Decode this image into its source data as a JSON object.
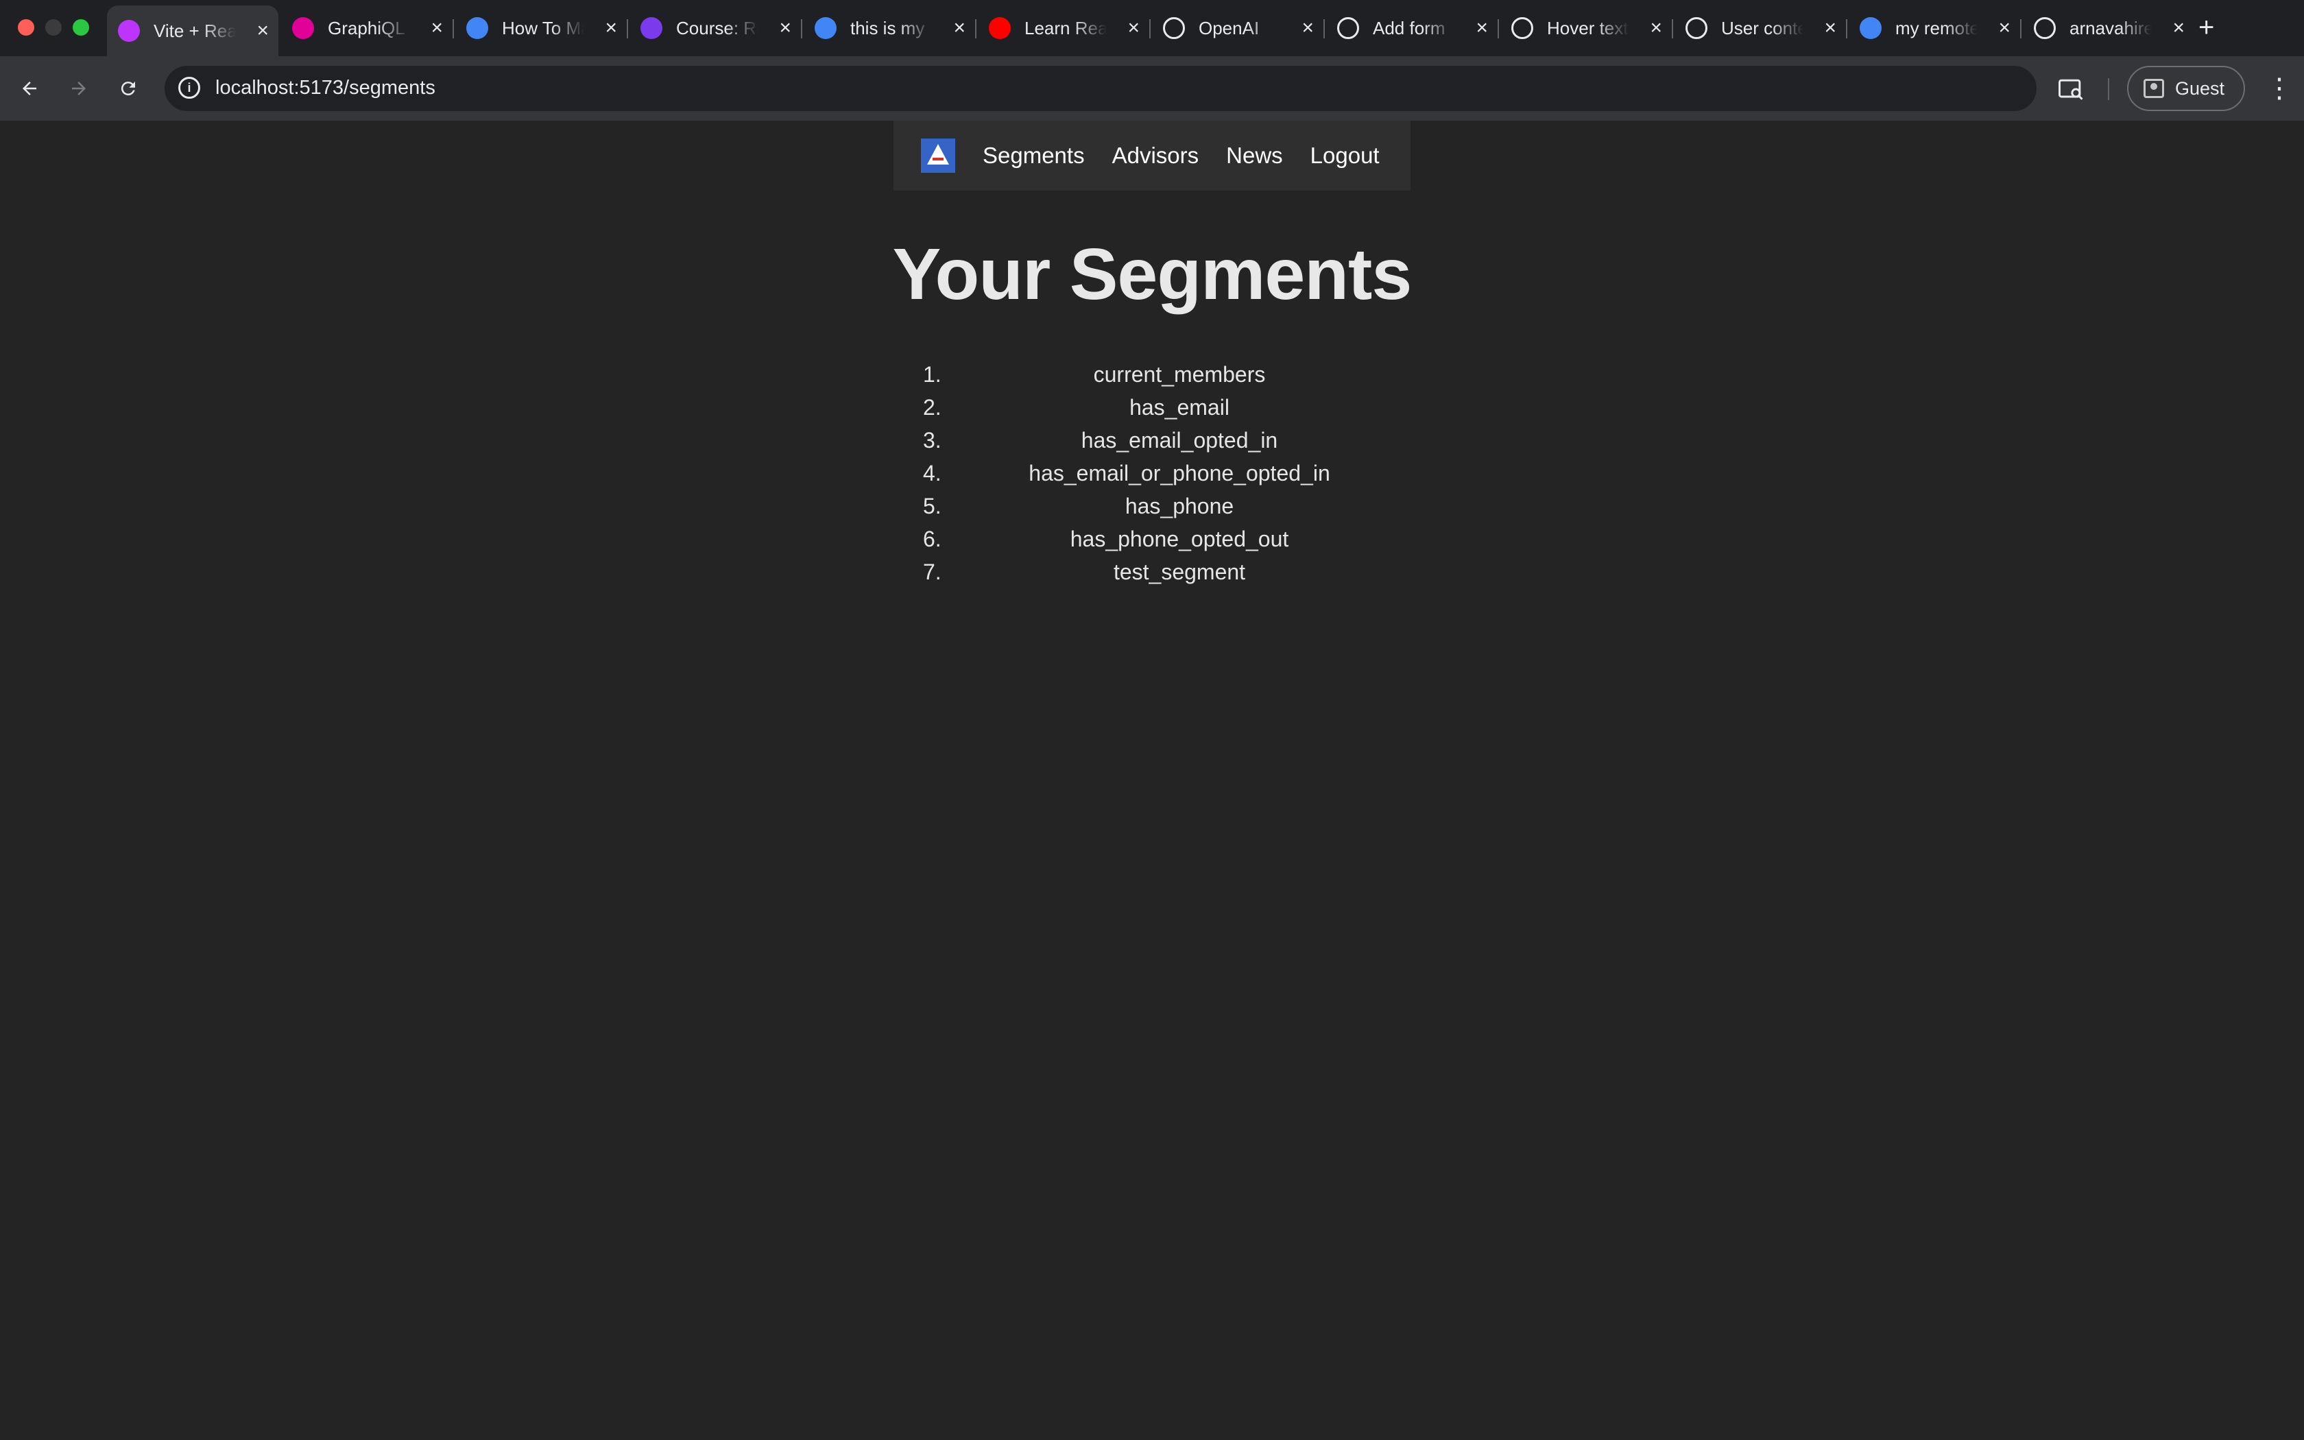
{
  "browser": {
    "tabs": [
      {
        "title": "Vite + React",
        "favicon": "vite-icon",
        "color": "#bd34fe",
        "active": true
      },
      {
        "title": "GraphiQL",
        "favicon": "graphiql-icon",
        "color": "#e10098",
        "active": false
      },
      {
        "title": "How To Make",
        "favicon": "loading-spinner-icon",
        "color": "#4285f4",
        "active": false
      },
      {
        "title": "Course: React",
        "favicon": "course-icon",
        "color": "#7c3aed",
        "active": false
      },
      {
        "title": "this is my",
        "favicon": "google-icon",
        "color": "#4285f4",
        "active": false
      },
      {
        "title": "Learn React",
        "favicon": "youtube-icon",
        "color": "#ff0000",
        "active": false
      },
      {
        "title": "OpenAI",
        "favicon": "openai-icon",
        "color": "#ffffff",
        "active": false
      },
      {
        "title": "Add form",
        "favicon": "openai-icon",
        "color": "#ffffff",
        "active": false
      },
      {
        "title": "Hover text",
        "favicon": "openai-icon",
        "color": "#ffffff",
        "active": false
      },
      {
        "title": "User context",
        "favicon": "openai-icon",
        "color": "#ffffff",
        "active": false
      },
      {
        "title": "my remote",
        "favicon": "google-icon",
        "color": "#4285f4",
        "active": false
      },
      {
        "title": "arnavahire",
        "favicon": "github-icon",
        "color": "#ffffff",
        "active": false
      }
    ],
    "new_tab_label": "+",
    "url": "localhost:5173/segments",
    "profile_label": "Guest"
  },
  "app": {
    "nav": {
      "links": [
        "Segments",
        "Advisors",
        "News",
        "Logout"
      ]
    },
    "title": "Your Segments",
    "segments": [
      "current_members",
      "has_email",
      "has_email_opted_in",
      "has_email_or_phone_opted_in",
      "has_phone",
      "has_phone_opted_out",
      "test_segment"
    ]
  }
}
